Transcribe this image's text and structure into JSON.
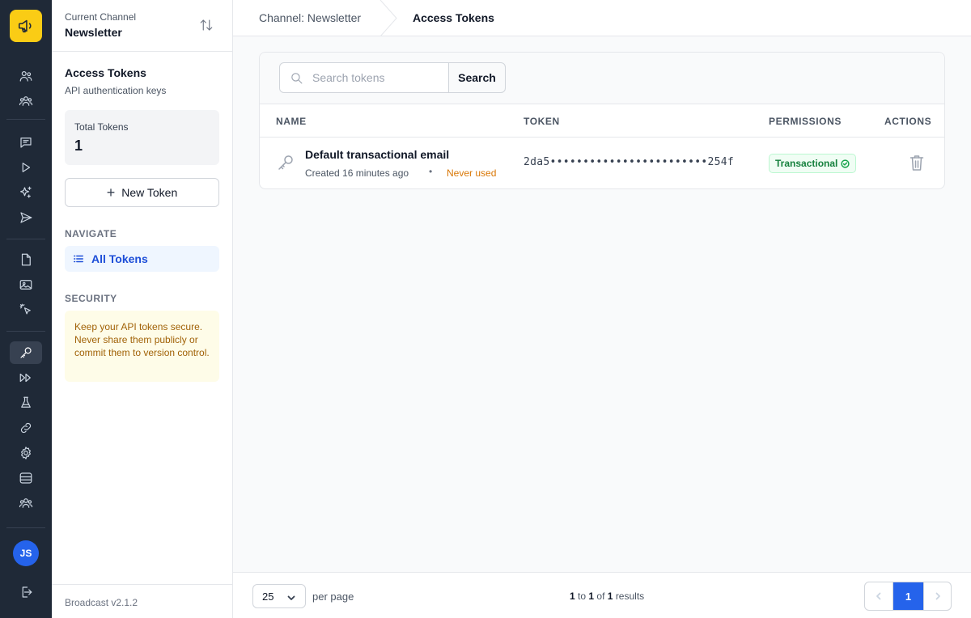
{
  "app": {
    "logo_icon": "megaphone-icon",
    "accent": "#2563eb",
    "rail_bg": "#1f2937",
    "user_initials": "JS"
  },
  "rail": {
    "icons": [
      "subscribers-icon",
      "segments-icon",
      "broadcasts-icon",
      "sequences-icon",
      "ai-sparkle-icon",
      "transactional-icon",
      "templates-icon",
      "media-icon",
      "tracking-icon",
      "key-icon",
      "webhooks-icon",
      "lab-icon",
      "link-icon",
      "gear-icon",
      "storage-icon",
      "users-icon",
      "logout-icon"
    ]
  },
  "sidebar": {
    "channel_label": "Current Channel",
    "channel_name": "Newsletter",
    "title": "Access Tokens",
    "subtitle": "API authentication keys",
    "stat_label": "Total Tokens",
    "stat_value": "1",
    "new_token_label": "New Token",
    "navigate_heading": "NAVIGATE",
    "nav_all_tokens": "All Tokens",
    "security_heading": "SECURITY",
    "security_note": "Keep your API tokens secure. Never share them publicly or commit them to version control.",
    "version": "Broadcast v2.1.2"
  },
  "header": {
    "breadcrumb_channel": "Channel: Newsletter",
    "breadcrumb_page": "Access Tokens"
  },
  "search": {
    "placeholder": "Search tokens",
    "button_label": "Search"
  },
  "table": {
    "columns": [
      "NAME",
      "TOKEN",
      "PERMISSIONS",
      "ACTIONS"
    ],
    "rows": [
      {
        "name": "Default transactional email",
        "created": "Created 16 minutes ago",
        "separator": "•",
        "last_used": "Never used",
        "token": "2da5••••••••••••••••••••••••254f",
        "permission": "Transactional"
      }
    ]
  },
  "footer": {
    "per_page_value": "25",
    "per_page_label": "per page",
    "results_from": "1",
    "results_to_word": "to",
    "results_to": "1",
    "results_of_word": "of",
    "results_total": "1",
    "results_word": "results",
    "current_page": "1"
  }
}
